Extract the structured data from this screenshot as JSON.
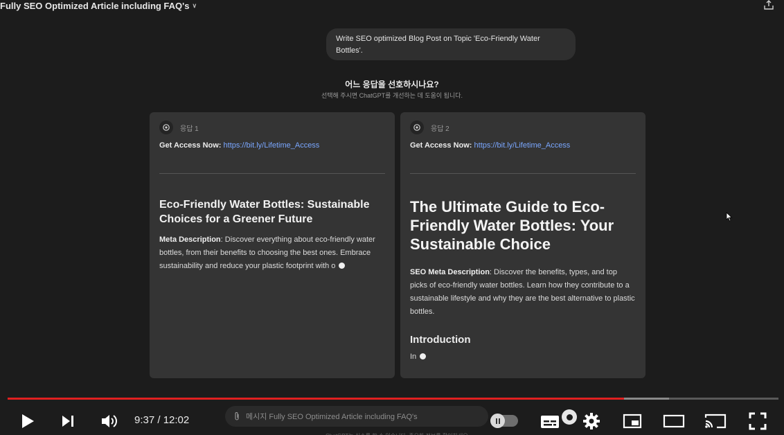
{
  "window": {
    "title": "Fully SEO Optimized Article including FAQ's"
  },
  "chat": {
    "user_message": "Write SEO optimized Blog Post on  Topic 'Eco-Friendly Water Bottles'.",
    "preference_question": "어느 응답을 선호하시나요?",
    "preference_subtext": "선택해 주시면 ChatGPT를 개선하는 데 도움이 됩니다."
  },
  "responses": [
    {
      "label": "응답 1",
      "access_label": "Get Access Now:",
      "access_link": "https://bit.ly/Lifetime_Access",
      "heading": "Eco-Friendly Water Bottles: Sustainable Choices for a Greener Future",
      "meta_label": "Meta Description",
      "meta_text": ": Discover everything about eco-friendly water bottles, from their benefits to choosing the best ones. Embrace sustainability and reduce your plastic footprint with o"
    },
    {
      "label": "응답 2",
      "access_label": "Get Access Now:",
      "access_link": "https://bit.ly/Lifetime_Access",
      "heading": "The Ultimate Guide to Eco-Friendly Water Bottles: Your Sustainable Choice",
      "meta_label": "SEO Meta Description",
      "meta_text": ": Discover the benefits, types, and top picks of eco-friendly water bottles. Learn how they contribute to a sustainable lifestyle and why they are the best alternative to plastic bottles.",
      "subheading": "Introduction",
      "body_tail": "In"
    }
  ],
  "composer": {
    "placeholder": "메시지 Fully SEO Optimized Article including FAQ's"
  },
  "player": {
    "time": "9:37 / 12:02",
    "progress_fraction": 0.8,
    "buffered_fraction": 0.858,
    "footer_hint": "ChatGPT는 실수를 할 수 있습니다. 중요한 정보를 확인하세요.",
    "accent_color": "#e02020"
  }
}
